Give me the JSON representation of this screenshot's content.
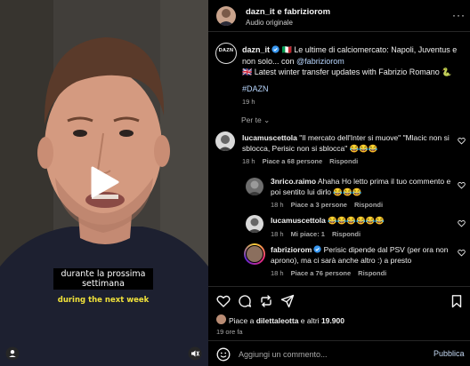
{
  "video": {
    "subtitle_it": "durante la prossima settimana",
    "subtitle_en": "during the next week",
    "icons": [
      "play-icon",
      "user-icon",
      "mute-icon"
    ]
  },
  "header": {
    "names": "dazn_it e fabriziorom",
    "audio": "Audio originale",
    "more": "···"
  },
  "caption": {
    "author": "dazn_it",
    "line1": " 🇮🇹 Le ultime di calciomercato: Napoli, Juventus e non solo... con ",
    "mention": "@fabriziorom",
    "line2": "🇬🇧 Latest winter transfer updates with Fabrizio Romano 🐍",
    "hashtag": "#DAZN",
    "time": "19 h",
    "logo_text": "DAZN"
  },
  "per_te": "Per te",
  "comments": [
    {
      "user": "lucamuscettola",
      "text": " \"Il mercato dell'Inter si muove\" \"Mlacic non si sblocca, Perisic non si sblocca\" 😂😂😂",
      "time": "18 h",
      "likes": "Piace a 68 persone",
      "reply": "Rispondi"
    },
    {
      "user": "3nrico.raimo",
      "text": " Ahaha Ho letto prima il tuo commento e poi sentito lui dirlo 😂😂😂",
      "time": "18 h",
      "likes": "Piace a 3 persone",
      "reply": "Rispondi"
    },
    {
      "user": "lucamuscettola",
      "text": " 😂😂😂😂😂😂",
      "time": "18 h",
      "likes": "Mi piace: 1",
      "reply": "Rispondi"
    },
    {
      "user": "fabriziorom",
      "text": " Perisic dipende dal PSV (per ora non aprono), ma ci sarà anche altro :) a presto",
      "time": "18 h",
      "likes": "Piace a 76 persone",
      "reply": "Rispondi"
    }
  ],
  "actions": {
    "likes_prefix": "Piace a ",
    "likes_user": "dilettaleotta",
    "likes_mid": " e altri ",
    "likes_count": "19.900",
    "ago": "19 ore fa",
    "icons": [
      "heart-icon",
      "comment-icon",
      "repost-icon",
      "share-icon",
      "bookmark-icon"
    ]
  },
  "add_comment": {
    "placeholder": "Aggiungi un commento...",
    "publish": "Pubblica"
  },
  "colors": {
    "accent": "#0095f6",
    "verified": "#3897f0",
    "muted": "#a8a8a8",
    "subtitle_yellow": "#f1e23a"
  }
}
